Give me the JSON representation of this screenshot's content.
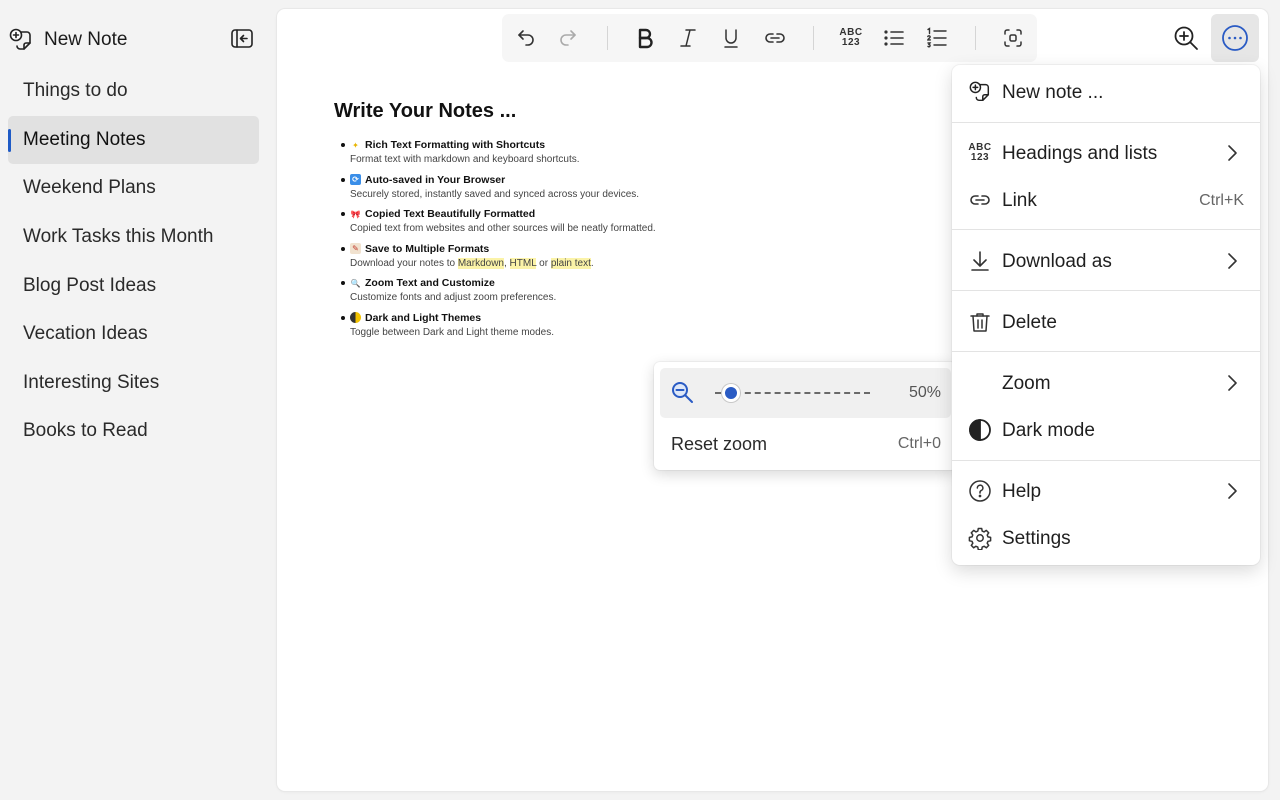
{
  "sidebar": {
    "new_note_label": "New Note",
    "notes": [
      {
        "label": "Things to do"
      },
      {
        "label": "Meeting Notes",
        "active": true
      },
      {
        "label": "Weekend Plans"
      },
      {
        "label": "Work Tasks this Month"
      },
      {
        "label": "Blog Post Ideas"
      },
      {
        "label": "Vecation Ideas"
      },
      {
        "label": "Interesting Sites"
      },
      {
        "label": "Books to Read"
      }
    ]
  },
  "toolbar": {
    "headings_icon_top": "ABC",
    "headings_icon_bottom": "123"
  },
  "note": {
    "title": "Write Your Notes ...",
    "features": [
      {
        "title": "Rich Text Formatting with Shortcuts",
        "desc": "Format text with markdown and keyboard shortcuts."
      },
      {
        "title": "Auto-saved in Your Browser",
        "desc": "Securely stored, instantly saved and synced across your devices."
      },
      {
        "title": "Copied Text Beautifully Formatted",
        "desc": "Copied text from websites and other sources will be neatly formatted."
      },
      {
        "title": "Save to Multiple Formats",
        "desc_prefix": "Download your notes to ",
        "fmt1": "Markdown",
        "sep1": ", ",
        "fmt2": "HTML",
        "sep2": " or ",
        "fmt3": "plain text",
        "desc_suffix": "."
      },
      {
        "title": "Zoom Text and Customize",
        "desc": "Customize fonts and adjust zoom preferences."
      },
      {
        "title": "Dark and Light Themes",
        "desc": "Toggle between Dark and Light theme modes."
      }
    ]
  },
  "zoom_popup": {
    "value_label": "50%",
    "zoom_fraction": 0.1,
    "reset_label": "Reset zoom",
    "reset_shortcut": "Ctrl+0"
  },
  "menu": {
    "new_note": "New note ...",
    "headings_and_lists": "Headings and lists",
    "link": "Link",
    "link_shortcut": "Ctrl+K",
    "download_as": "Download as",
    "delete": "Delete",
    "zoom": "Zoom",
    "dark_mode": "Dark mode",
    "help": "Help",
    "settings": "Settings"
  },
  "colors": {
    "accent": "#1f5bc6",
    "highlight": "#fbf3a8"
  }
}
